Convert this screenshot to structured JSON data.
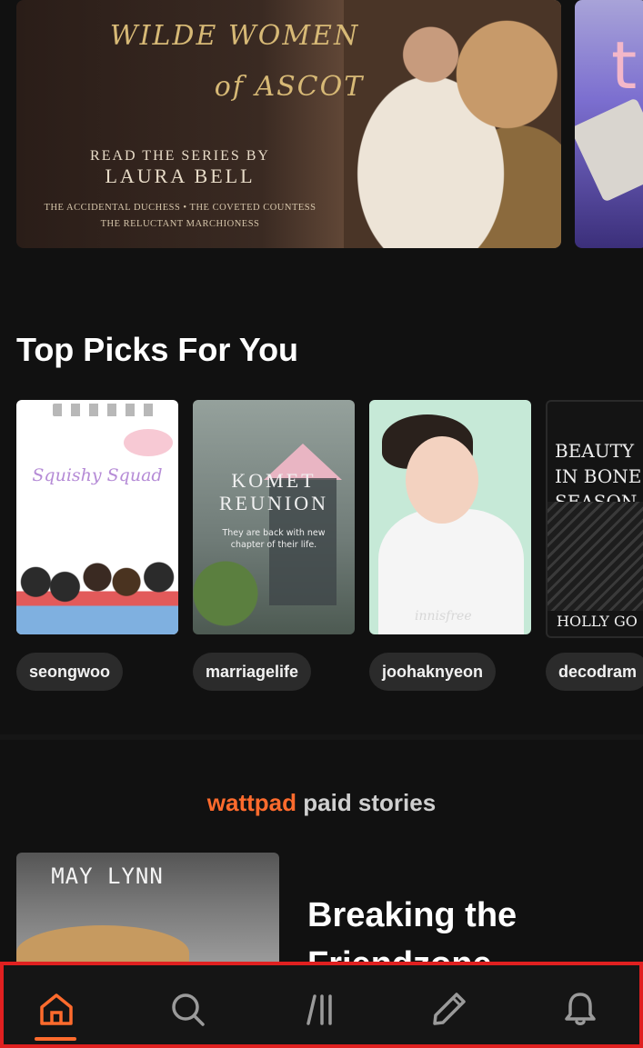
{
  "hero": {
    "title_line1": "WILDE WOMEN",
    "title_line2": "of ASCOT",
    "series_line1": "READ THE SERIES BY",
    "series_line2": "LAURA BELL",
    "books_line1": "THE ACCIDENTAL DUCHESS • THE COVETED COUNTESS",
    "books_line2": "THE RELUCTANT MARCHIONESS",
    "second_letter": "t"
  },
  "top_picks": {
    "title": "Top Picks For You",
    "items": [
      {
        "tag": "seongwoo",
        "cover_text": "Squishy Squad"
      },
      {
        "tag": "marriagelife",
        "cover_title_line1": "KOMET",
        "cover_title_line2": "REUNION",
        "cover_sub": "They are back with new chapter of their life."
      },
      {
        "tag": "joohaknyeon",
        "cover_brand": "innisfree"
      },
      {
        "tag": "decodram",
        "cover_title": "BEAUTY IN BONE SEASON",
        "cover_author": "HOLLY GO"
      }
    ]
  },
  "paid": {
    "brand": "wattpad",
    "rest": " paid stories",
    "cover_author": "MAY LYNN",
    "story_title": "Breaking the Friendzone"
  },
  "nav": {
    "items": [
      {
        "name": "home",
        "icon": "home-icon",
        "active": true
      },
      {
        "name": "search",
        "icon": "search-icon",
        "active": false
      },
      {
        "name": "library",
        "icon": "library-icon",
        "active": false
      },
      {
        "name": "write",
        "icon": "pencil-icon",
        "active": false
      },
      {
        "name": "notifications",
        "icon": "bell-icon",
        "active": false
      }
    ],
    "accent": "#ff6b2d",
    "highlight_border": "#e02020"
  }
}
